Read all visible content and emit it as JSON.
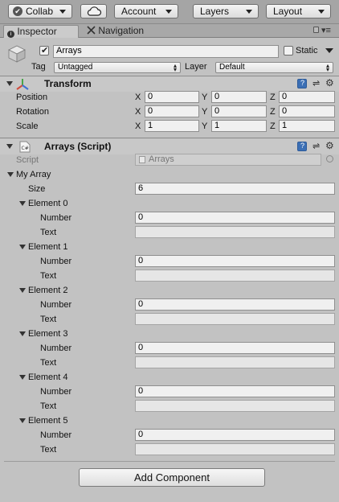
{
  "toolbar": {
    "collab_label": "Collab",
    "account_label": "Account",
    "layers_label": "Layers",
    "layout_label": "Layout"
  },
  "tabs": [
    {
      "label": "Inspector",
      "active": true
    },
    {
      "label": "Navigation",
      "active": false
    }
  ],
  "object": {
    "name": "Arrays",
    "active": true,
    "static_label": "Static",
    "static_checked": false,
    "tag_label": "Tag",
    "tag_value": "Untagged",
    "layer_label": "Layer",
    "layer_value": "Default"
  },
  "transform": {
    "title": "Transform",
    "rows": [
      {
        "label": "Position",
        "x": "0",
        "y": "0",
        "z": "0"
      },
      {
        "label": "Rotation",
        "x": "0",
        "y": "0",
        "z": "0"
      },
      {
        "label": "Scale",
        "x": "1",
        "y": "1",
        "z": "1"
      }
    ],
    "axes": [
      "X",
      "Y",
      "Z"
    ]
  },
  "script_component": {
    "title": "Arrays (Script)",
    "script_label": "Script",
    "script_value": "Arrays",
    "array_label": "My Array",
    "size_label": "Size",
    "size_value": "6",
    "element_prefix": "Element",
    "number_label": "Number",
    "text_label": "Text",
    "elements": [
      {
        "label": "Element 0",
        "number": "0",
        "text": ""
      },
      {
        "label": "Element 1",
        "number": "0",
        "text": ""
      },
      {
        "label": "Element 2",
        "number": "0",
        "text": ""
      },
      {
        "label": "Element 3",
        "number": "0",
        "text": ""
      },
      {
        "label": "Element 4",
        "number": "0",
        "text": ""
      },
      {
        "label": "Element 5",
        "number": "0",
        "text": ""
      }
    ]
  },
  "add_component_label": "Add Component",
  "colors": {
    "panel": "#c2c2c2",
    "toolbar": "#a5a5a5",
    "transform_icon_red": "#d24b3c",
    "transform_icon_green": "#48a548",
    "transform_icon_blue": "#3e6fd4",
    "help_icon": "#3b6fb5"
  }
}
